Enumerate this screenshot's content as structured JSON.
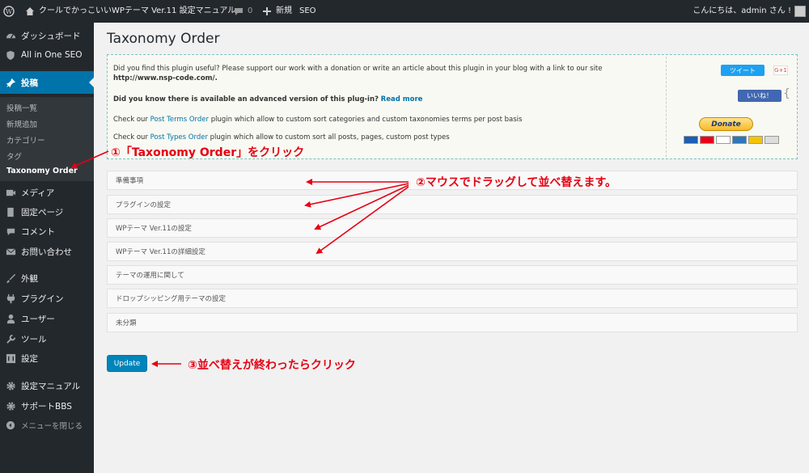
{
  "adminbar": {
    "site_title": "クールでかっこいいWPテーマ Ver.11 設定マニュアル",
    "comments_count": "0",
    "new_label": "新規",
    "seo_label": "SEO",
    "howdy": "こんにちは、admin さん !"
  },
  "sidebar": {
    "items": [
      {
        "label": "ダッシュボード",
        "icon": "dashboard-icon"
      },
      {
        "label": "All in One SEO",
        "icon": "seo-shield-icon"
      },
      {
        "label": "投稿",
        "icon": "pin-icon"
      },
      {
        "label": "メディア",
        "icon": "media-icon"
      },
      {
        "label": "固定ページ",
        "icon": "page-icon"
      },
      {
        "label": "コメント",
        "icon": "comment-icon"
      },
      {
        "label": "お問い合わせ",
        "icon": "mail-icon"
      },
      {
        "label": "外観",
        "icon": "brush-icon"
      },
      {
        "label": "プラグイン",
        "icon": "plugin-icon"
      },
      {
        "label": "ユーザー",
        "icon": "user-icon"
      },
      {
        "label": "ツール",
        "icon": "wrench-icon"
      },
      {
        "label": "設定",
        "icon": "settings-icon"
      },
      {
        "label": "設定マニュアル",
        "icon": "gear-icon"
      },
      {
        "label": "サポートBBS",
        "icon": "gear-icon"
      },
      {
        "label": "メニューを閉じる",
        "icon": "collapse-icon"
      }
    ],
    "submenu": [
      "投稿一覧",
      "新規追加",
      "カテゴリー",
      "タグ",
      "Taxonomy Order"
    ]
  },
  "main": {
    "title": "Taxonomy Order",
    "info": {
      "line1": "Did you find this plugin useful? Please support our work with a donation or write an article about this plugin in your blog with a link to our site",
      "line1_url": "http://www.nsp-code.com/.",
      "line2": "Did you know there is available an advanced version of this plug-in?",
      "line2_link": "Read more",
      "line3_pre": "Check our",
      "line3_link": "Post Terms Order",
      "line3_post": "plugin which allow to custom sort categories and custom taxonomies terms per post basis",
      "line4_pre": "Check our",
      "line4_link": "Post Types Order",
      "line4_post": "plugin which allow to custom sort all posts, pages, custom post types"
    },
    "social": {
      "tweet": "ツイート",
      "gplus": "G+1",
      "like": "いいね！",
      "donate": "Donate"
    },
    "terms": [
      "準備事項",
      "プラグインの設定",
      "WPテーマ Ver.11の設定",
      "WPテーマ Ver.11の詳細設定",
      "テーマの運用に関して",
      "ドロップシッピング用テーマの設定",
      "未分類"
    ],
    "update_label": "Update"
  },
  "annotations": {
    "a1": "①「Taxonomy Order」をクリック",
    "a2": "②マウスでドラッグして並べ替えます。",
    "a3": "③並べ替えが終わったらクリック"
  },
  "colors": {
    "admin_bg": "#23282d",
    "active": "#0073aa",
    "annotation": "#e60012",
    "update": "#0085ba"
  }
}
